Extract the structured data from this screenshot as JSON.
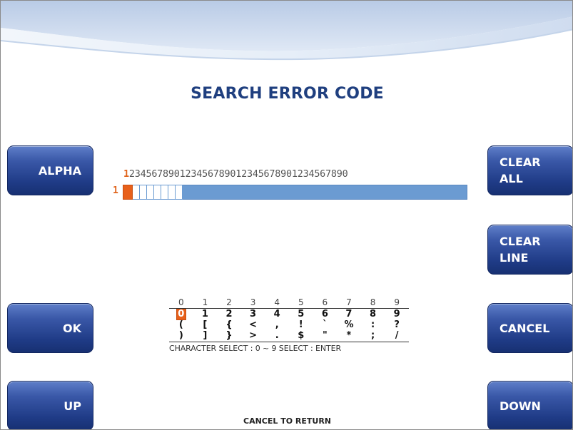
{
  "screen": {
    "title": "SEARCH ERROR CODE",
    "footer": "CANCEL TO RETURN"
  },
  "buttons": {
    "alpha": "ALPHA",
    "ok": "OK",
    "up": "UP",
    "clear_all": "CLEAR\nALL",
    "clear_line": "CLEAR\nLINE",
    "cancel": "CANCEL",
    "down": "DOWN"
  },
  "entry": {
    "ruler_cursor_digit": "1",
    "ruler_rest": "234567890123456789012345678901234567890",
    "row_number": "1",
    "entered_value": ""
  },
  "char_select": {
    "header": [
      "0",
      "1",
      "2",
      "3",
      "4",
      "5",
      "6",
      "7",
      "8",
      "9"
    ],
    "rows": [
      [
        "0",
        "1",
        "2",
        "3",
        "4",
        "5",
        "6",
        "7",
        "8",
        "9"
      ],
      [
        "(",
        "[",
        "{",
        "<",
        ",",
        "!",
        "`",
        "%",
        ":",
        "?"
      ],
      [
        ")",
        "]",
        "}",
        ">",
        ".",
        "$",
        "\"",
        "*",
        ";",
        "/"
      ]
    ],
    "selected": "0",
    "hint": "CHARACTER SELECT : 0 ~ 9  SELECT : ENTER"
  },
  "colors": {
    "accent": "#e8601a",
    "title": "#1f3f7f",
    "button": "#1f3b86",
    "field": "#6b9bd2"
  }
}
